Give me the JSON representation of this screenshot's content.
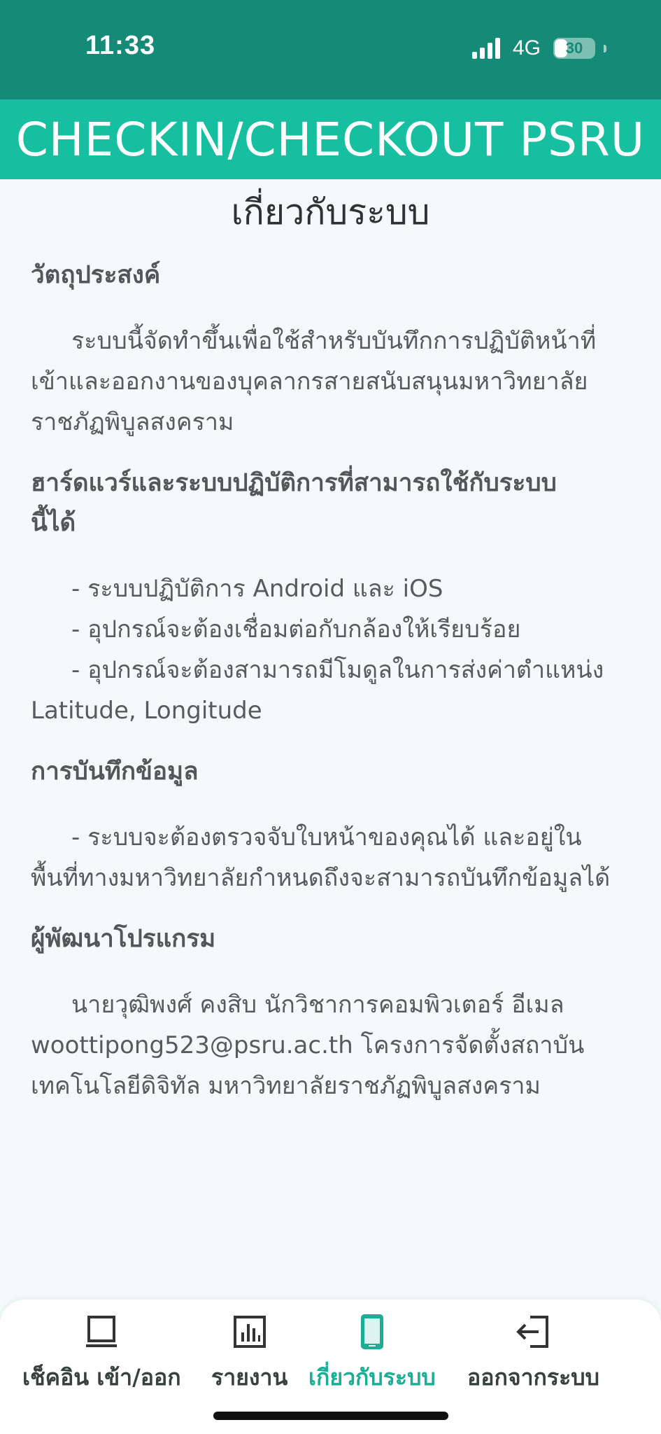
{
  "status_bar": {
    "time": "11:33",
    "network": "4G",
    "battery": "30",
    "battery_level": 0.3
  },
  "app_bar": {
    "title": "CHECKIN/CHECKOUT PSRU"
  },
  "page": {
    "title": "เกี่ยวกับระบบ",
    "sections": {
      "objective": {
        "heading": "วัตถุประสงค์",
        "lines": [
          "ระบบนี้จัดทำขึ้นเพื่อใช้สำหรับบันทึกการปฏิบัติหน้าที่",
          "เข้าและออกงานของบุคลากรสายสนับสนุนมหาวิทยาลัย",
          "ราชภัฏพิบูลสงคราม"
        ]
      },
      "hardware": {
        "heading_line1": "ฮาร์ดแวร์และระบบปฏิบัติการที่สามารถใช้กับระบบ",
        "heading_line2": "นี้ได้",
        "item1": "- ระบบปฏิบัติการ Android และ iOS",
        "item2": "- อุปกรณ์จะต้องเชื่อมต่อกับกล้องให้เรียบร้อย",
        "item3_line1": "- อุปกรณ์จะต้องสามารถมีโมดูลในการส่งค่าตำแหน่ง",
        "item3_line2": "Latitude, Longitude"
      },
      "recording": {
        "heading": "การบันทึกข้อมูล",
        "line1": "- ระบบจะต้องตรวจจับใบหน้าของคุณได้ และอยู่ใน",
        "line2": "พื้นที่ทางมหาวิทยาลัยกำหนดถึงจะสามารถบันทึกข้อมูลได้"
      },
      "developer": {
        "heading": "ผู้พัฒนาโปรแกรม",
        "line1": "นายวุฒิพงศ์ คงสิบ นักวิชาการคอมพิวเตอร์ อีเมล",
        "line2": "woottipong523@psru.ac.th โครงการจัดตั้งสถาบัน",
        "line3": "เทคโนโลยีดิจิทัล มหาวิทยาลัยราชภัฏพิบูลสงคราม"
      }
    }
  },
  "bottom_nav": {
    "items": [
      {
        "label": "เช็คอิน เข้า/ออก",
        "icon": "book-icon",
        "active": false
      },
      {
        "label": "รายงาน",
        "icon": "bar-chart-icon",
        "active": false
      },
      {
        "label": "เกี่ยวกับระบบ",
        "icon": "phone-icon",
        "active": true
      },
      {
        "label": "ออกจากระบบ",
        "icon": "logout-icon",
        "active": false
      }
    ]
  },
  "colors": {
    "status_bar_bg": "#148a77",
    "app_bar_bg": "#15bfa0",
    "active_nav": "#1bae95",
    "page_bg": "#f4fafa"
  }
}
